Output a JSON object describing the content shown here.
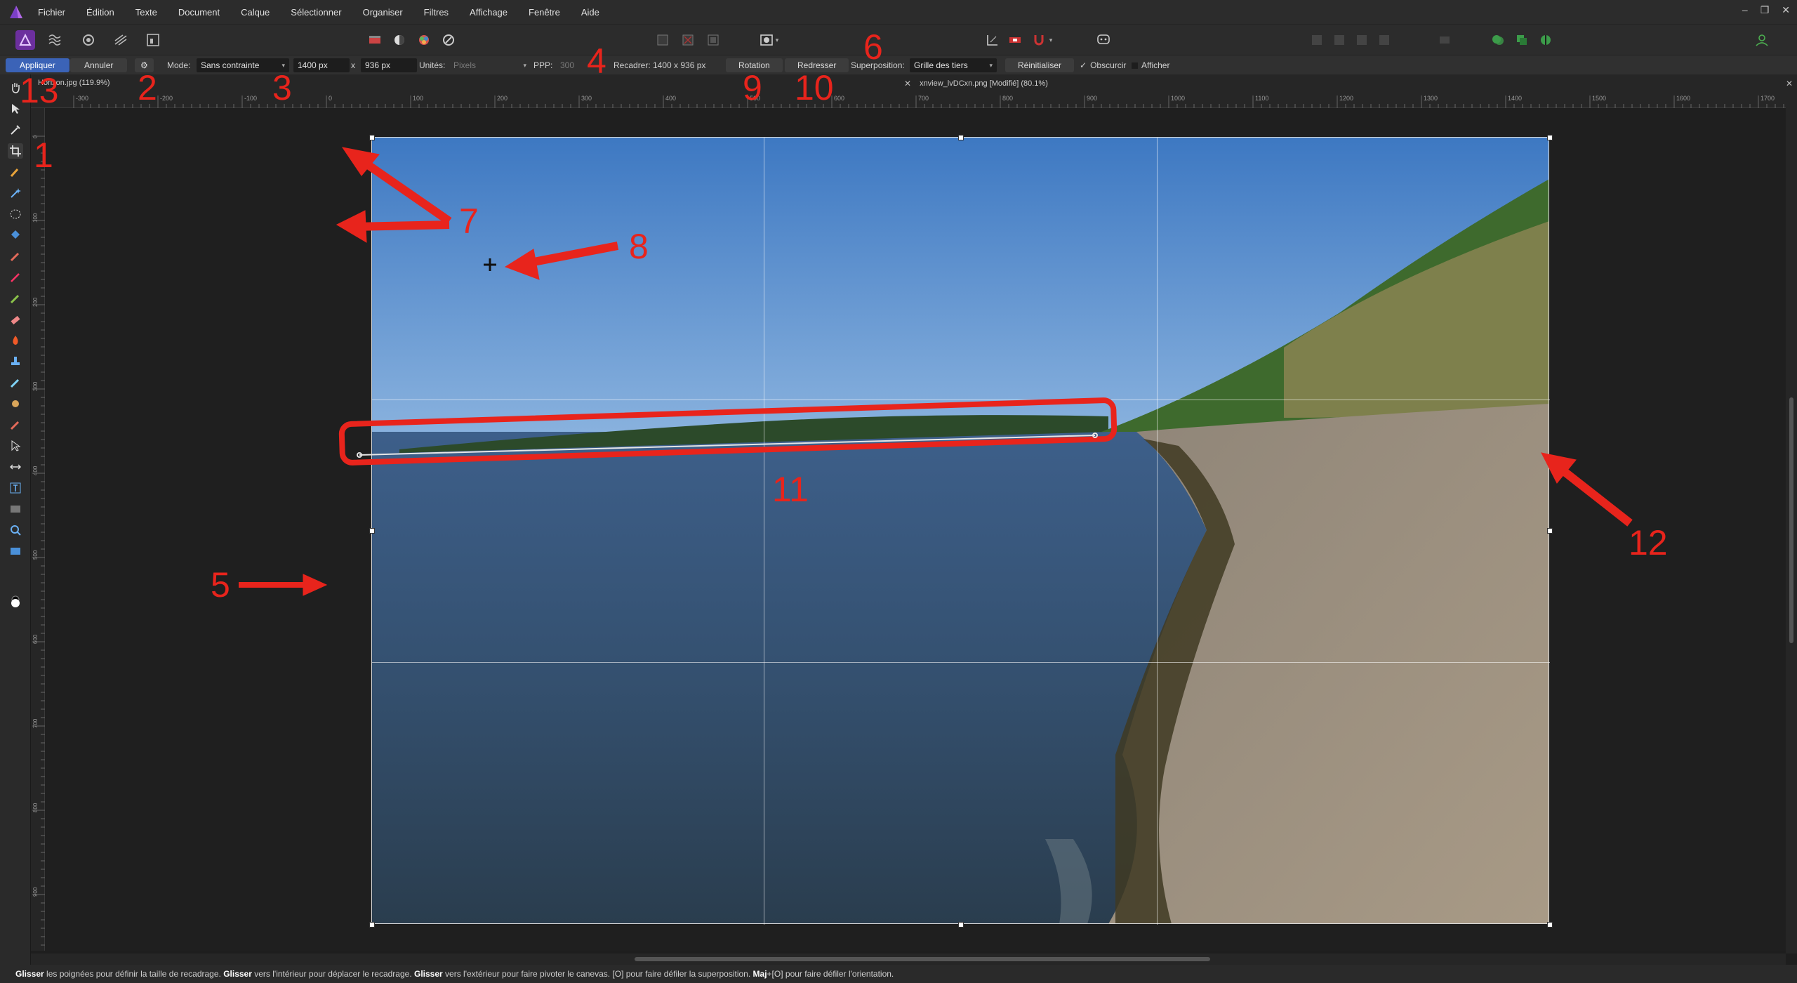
{
  "menu": [
    "Fichier",
    "Édition",
    "Texte",
    "Document",
    "Calque",
    "Sélectionner",
    "Organiser",
    "Filtres",
    "Affichage",
    "Fenêtre",
    "Aide"
  ],
  "context": {
    "apply": "Appliquer",
    "cancel": "Annuler",
    "mode_label": "Mode:",
    "mode_value": "Sans contrainte",
    "width": "1400 px",
    "times": "x",
    "height": "936 px",
    "units_label": "Unités:",
    "units_value": "Pixels",
    "ppp_label": "PPP:",
    "ppp_value": "300",
    "recadrer_label": "Recadrer:",
    "recadrer_value": "1400 x 936 px",
    "rotation": "Rotation",
    "redresser": "Redresser",
    "overlay_label": "Superposition:",
    "overlay_value": "Grille des tiers",
    "reset": "Réinitialiser",
    "obscurcir": "Obscurcir",
    "afficher": "Afficher"
  },
  "tabs": [
    {
      "title": "Horizon.jpg (119.9%)"
    },
    {
      "title": "xnview_lvDCxn.png [Modifié] (80.1%)"
    }
  ],
  "ruler_labels": [
    "-300",
    "-200",
    "-100",
    "0",
    "100",
    "200",
    "300",
    "400",
    "500",
    "600",
    "700",
    "800",
    "900",
    "1000",
    "1100",
    "1200",
    "1300",
    "1400",
    "1500",
    "1600",
    "1700"
  ],
  "vruler_labels": [
    "0",
    "100",
    "200",
    "300",
    "400",
    "500",
    "600",
    "700",
    "800",
    "900"
  ],
  "status": {
    "parts": [
      {
        "b": "Glisser",
        "t": " les poignées pour définir la taille de recadrage. "
      },
      {
        "b": "Glisser",
        "t": " vers l'intérieur pour déplacer le recadrage. "
      },
      {
        "b": "Glisser",
        "t": " vers l'extérieur pour faire pivoter le canevas. [O] pour faire défiler la superposition. "
      },
      {
        "b": "Maj",
        "t": "+[O] pour faire défiler l'orientation."
      }
    ]
  },
  "annotations": [
    "1",
    "2",
    "3",
    "4",
    "5",
    "6",
    "7",
    "8",
    "9",
    "10",
    "11",
    "12",
    "13"
  ],
  "colors": {
    "accent": "#3b63b7",
    "annotation": "#e8241c",
    "persona": "#6c2f9e"
  }
}
